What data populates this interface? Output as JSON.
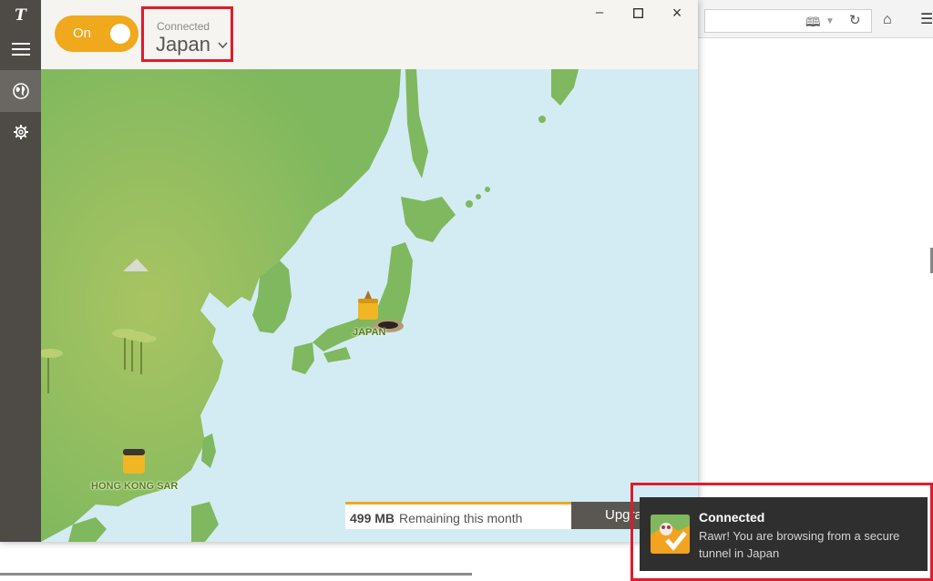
{
  "app": {
    "logo_icon": "tunnelbear-logo-icon",
    "nav_items": [
      {
        "id": "menu",
        "icon": "hamburger-menu-icon"
      },
      {
        "id": "map",
        "icon": "globe-icon"
      },
      {
        "id": "settings",
        "icon": "gear-icon"
      }
    ],
    "toggle": {
      "label": "On",
      "state": true
    },
    "location": {
      "status": "Connected",
      "country": "Japan",
      "chevron_icon": "chevron-down-icon"
    },
    "window_controls": {
      "minimize": "minimize-icon",
      "maximize": "maximize-icon",
      "close": "close-icon"
    },
    "map_labels": {
      "japan": "JAPAN",
      "hong_kong": "HONG KONG SAR"
    },
    "quota": {
      "amount": "499 MB",
      "text": "Remaining this month"
    },
    "upgrade_label": "Upgrade"
  },
  "browser": {
    "icons": [
      "reader-view-icon",
      "dropdown-icon",
      "reload-icon",
      "home-icon",
      "menu-icon"
    ]
  },
  "notification": {
    "title": "Connected",
    "body": "Rawr! You are browsing from a secure tunnel in Japan",
    "icon": "tunnelbear-check-icon"
  },
  "colors": {
    "accent": "#f0a81c",
    "highlight": "#e01b2a",
    "sidebar": "#4e4a46",
    "sea": "#d3ecf3",
    "land": "#7fb85e"
  }
}
